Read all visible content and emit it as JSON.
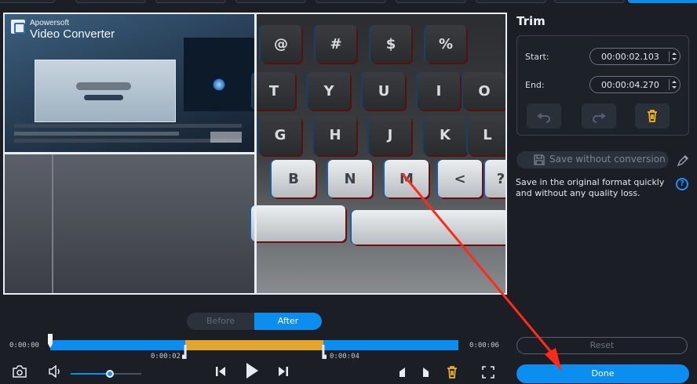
{
  "video_overlay": {
    "brand": "Apowersoft",
    "product": "Video Converter"
  },
  "trim": {
    "title": "Trim",
    "start_label": "Start:",
    "start_value": "00:00:02.103",
    "end_label": "End:",
    "end_value": "00:00:04.270"
  },
  "save": {
    "button_label": "Save without conversion",
    "description": "Save in the original format quickly and without any quality loss.",
    "help_glyph": "?"
  },
  "preview_toggle": {
    "before_label": "Before",
    "after_label": "After",
    "selected": "After"
  },
  "timeline": {
    "start_time": "0:00:00",
    "end_time": "0:00:06",
    "selection_start_time": "0:00:02",
    "selection_end_time": "0:00:04",
    "selection_start_fraction": 0.33,
    "selection_end_fraction": 0.67
  },
  "volume": {
    "level": 0.55
  },
  "actions": {
    "reset_label": "Reset",
    "done_label": "Done"
  },
  "colors": {
    "accent": "#0b8ef0",
    "selection": "#e2a52f",
    "background": "#1b1e24",
    "annotation_arrow": "#ff2a1a"
  },
  "icons": {
    "snapshot": "camera-icon",
    "volume": "speaker-icon",
    "prev_frame": "step-back-icon",
    "play": "play-icon",
    "next_frame": "step-forward-icon",
    "mark_in": "mark-in-icon",
    "mark_out": "mark-out-icon",
    "delete": "trash-icon",
    "fullscreen": "fullscreen-icon",
    "undo": "undo-icon",
    "redo": "redo-icon",
    "edit": "pencil-icon"
  }
}
